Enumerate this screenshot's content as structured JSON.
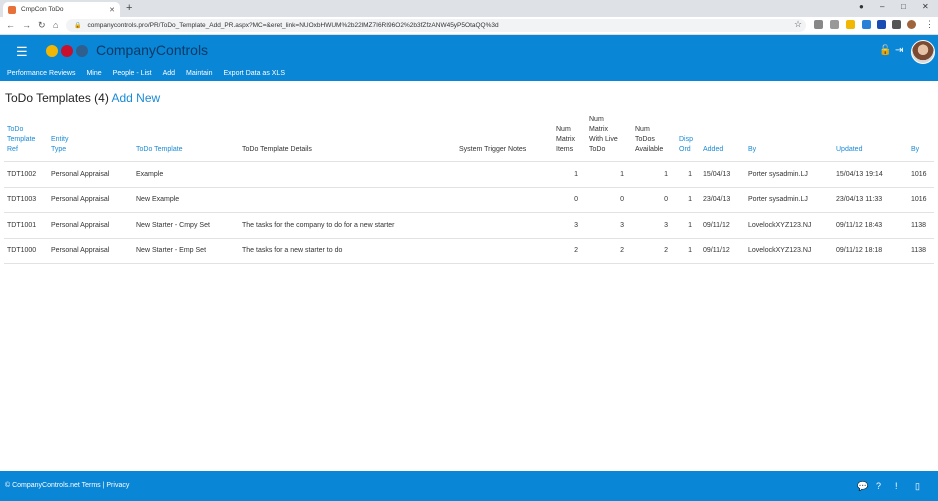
{
  "browser": {
    "tab_title": "CmpCon ToDo",
    "url": "companycontrols.pro/PR/ToDo_Template_Add_PR.aspx?MC=&eret_link=NUOxbHWUM%2b22lMZ7I6RI96O2%2b3fZfzANW45yP5OtaQQ%3d"
  },
  "app": {
    "brand": "CompanyControls",
    "menu": [
      "Performance Reviews",
      "Mine",
      "People - List",
      "Add",
      "Maintain",
      "Export Data as XLS"
    ]
  },
  "page": {
    "title": "ToDo Templates (4)",
    "add_new": "Add New"
  },
  "table": {
    "headers": {
      "ref": [
        "ToDo",
        "Template",
        "Ref"
      ],
      "entity": [
        "Entity",
        "Type"
      ],
      "template": "ToDo Template",
      "details": "ToDo Template Details",
      "trigger": "System Trigger Notes",
      "matrix_items": [
        "Num",
        "Matrix",
        "Items"
      ],
      "matrix_live": [
        "Num",
        "Matrix",
        "With Live",
        "ToDo"
      ],
      "todos_avail": [
        "Num",
        "ToDos",
        "Available"
      ],
      "disp_ord": [
        "Disp",
        "Ord"
      ],
      "added": "Added",
      "by1": "By",
      "updated": "Updated",
      "by2": "By"
    },
    "rows": [
      {
        "ref": "TDT1002",
        "entity": "Personal Appraisal",
        "template": "Example",
        "details": "",
        "trigger": "",
        "matrix_items": "1",
        "matrix_live": "1",
        "todos_avail": "1",
        "disp_ord": "1",
        "added": "15/04/13",
        "by1": "Porter sysadmin.LJ",
        "updated": "15/04/13 19:14",
        "by2": "1016"
      },
      {
        "ref": "TDT1003",
        "entity": "Personal Appraisal",
        "template": "New Example",
        "details": "",
        "trigger": "",
        "matrix_items": "0",
        "matrix_live": "0",
        "todos_avail": "0",
        "disp_ord": "1",
        "added": "23/04/13",
        "by1": "Porter sysadmin.LJ",
        "updated": "23/04/13 11:33",
        "by2": "1016"
      },
      {
        "ref": "TDT1001",
        "entity": "Personal Appraisal",
        "template": "New Starter - Cmpy Set",
        "details": "The tasks for the company to do for a new starter",
        "trigger": "",
        "matrix_items": "3",
        "matrix_live": "3",
        "todos_avail": "3",
        "disp_ord": "1",
        "added": "09/11/12",
        "by1": "LovelockXYZ123.NJ",
        "updated": "09/11/12 18:43",
        "by2": "1138"
      },
      {
        "ref": "TDT1000",
        "entity": "Personal Appraisal",
        "template": "New Starter - Emp Set",
        "details": "The tasks for a new starter to do",
        "trigger": "",
        "matrix_items": "2",
        "matrix_live": "2",
        "todos_avail": "2",
        "disp_ord": "1",
        "added": "09/11/12",
        "by1": "LovelockXYZ123.NJ",
        "updated": "09/11/12 18:18",
        "by2": "1138"
      }
    ]
  },
  "footer": {
    "text": "© CompanyControls.net Terms | Privacy"
  },
  "colors": {
    "primary": "#0a86d6",
    "link": "#1a8ad6",
    "logo_dots": [
      "#f2b705",
      "#c8102e",
      "#2f5f8f"
    ]
  }
}
